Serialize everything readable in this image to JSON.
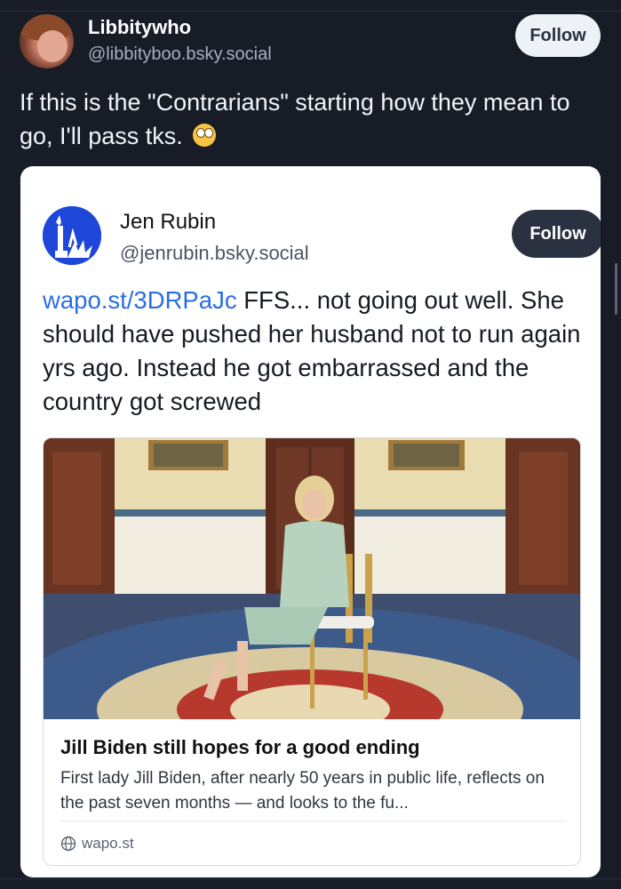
{
  "post": {
    "author_name": "Libbitywho",
    "author_handle": "@libbityboo.bsky.social",
    "follow_label": "Follow",
    "text": "If this is the \"Contrarians\" starting how they mean to go, I'll pass tks.",
    "emoji": "rolling-eyes-emoji"
  },
  "quoted_post": {
    "author_name": "Jen Rubin",
    "author_handle": "@jenrubin.bsky.social",
    "follow_label": "Follow",
    "link_text": "wapo.st/3DRPaJc",
    "text": " FFS... not going out well. She should have pushed her husband not to run again yrs ago. Instead he got embarrassed and the country got screwed"
  },
  "link_card": {
    "title": "Jill Biden still hopes for a good ending",
    "description": "First lady Jill Biden, after nearly 50 years in public life, reflects on the past seven months — and looks to the fu...",
    "domain": "wapo.st"
  },
  "colors": {
    "background": "#171c26",
    "link": "#2c6ee0",
    "follow_light": "#eef1f5",
    "follow_dark": "#2a3140",
    "quoted_avatar": "#1e46d8"
  }
}
